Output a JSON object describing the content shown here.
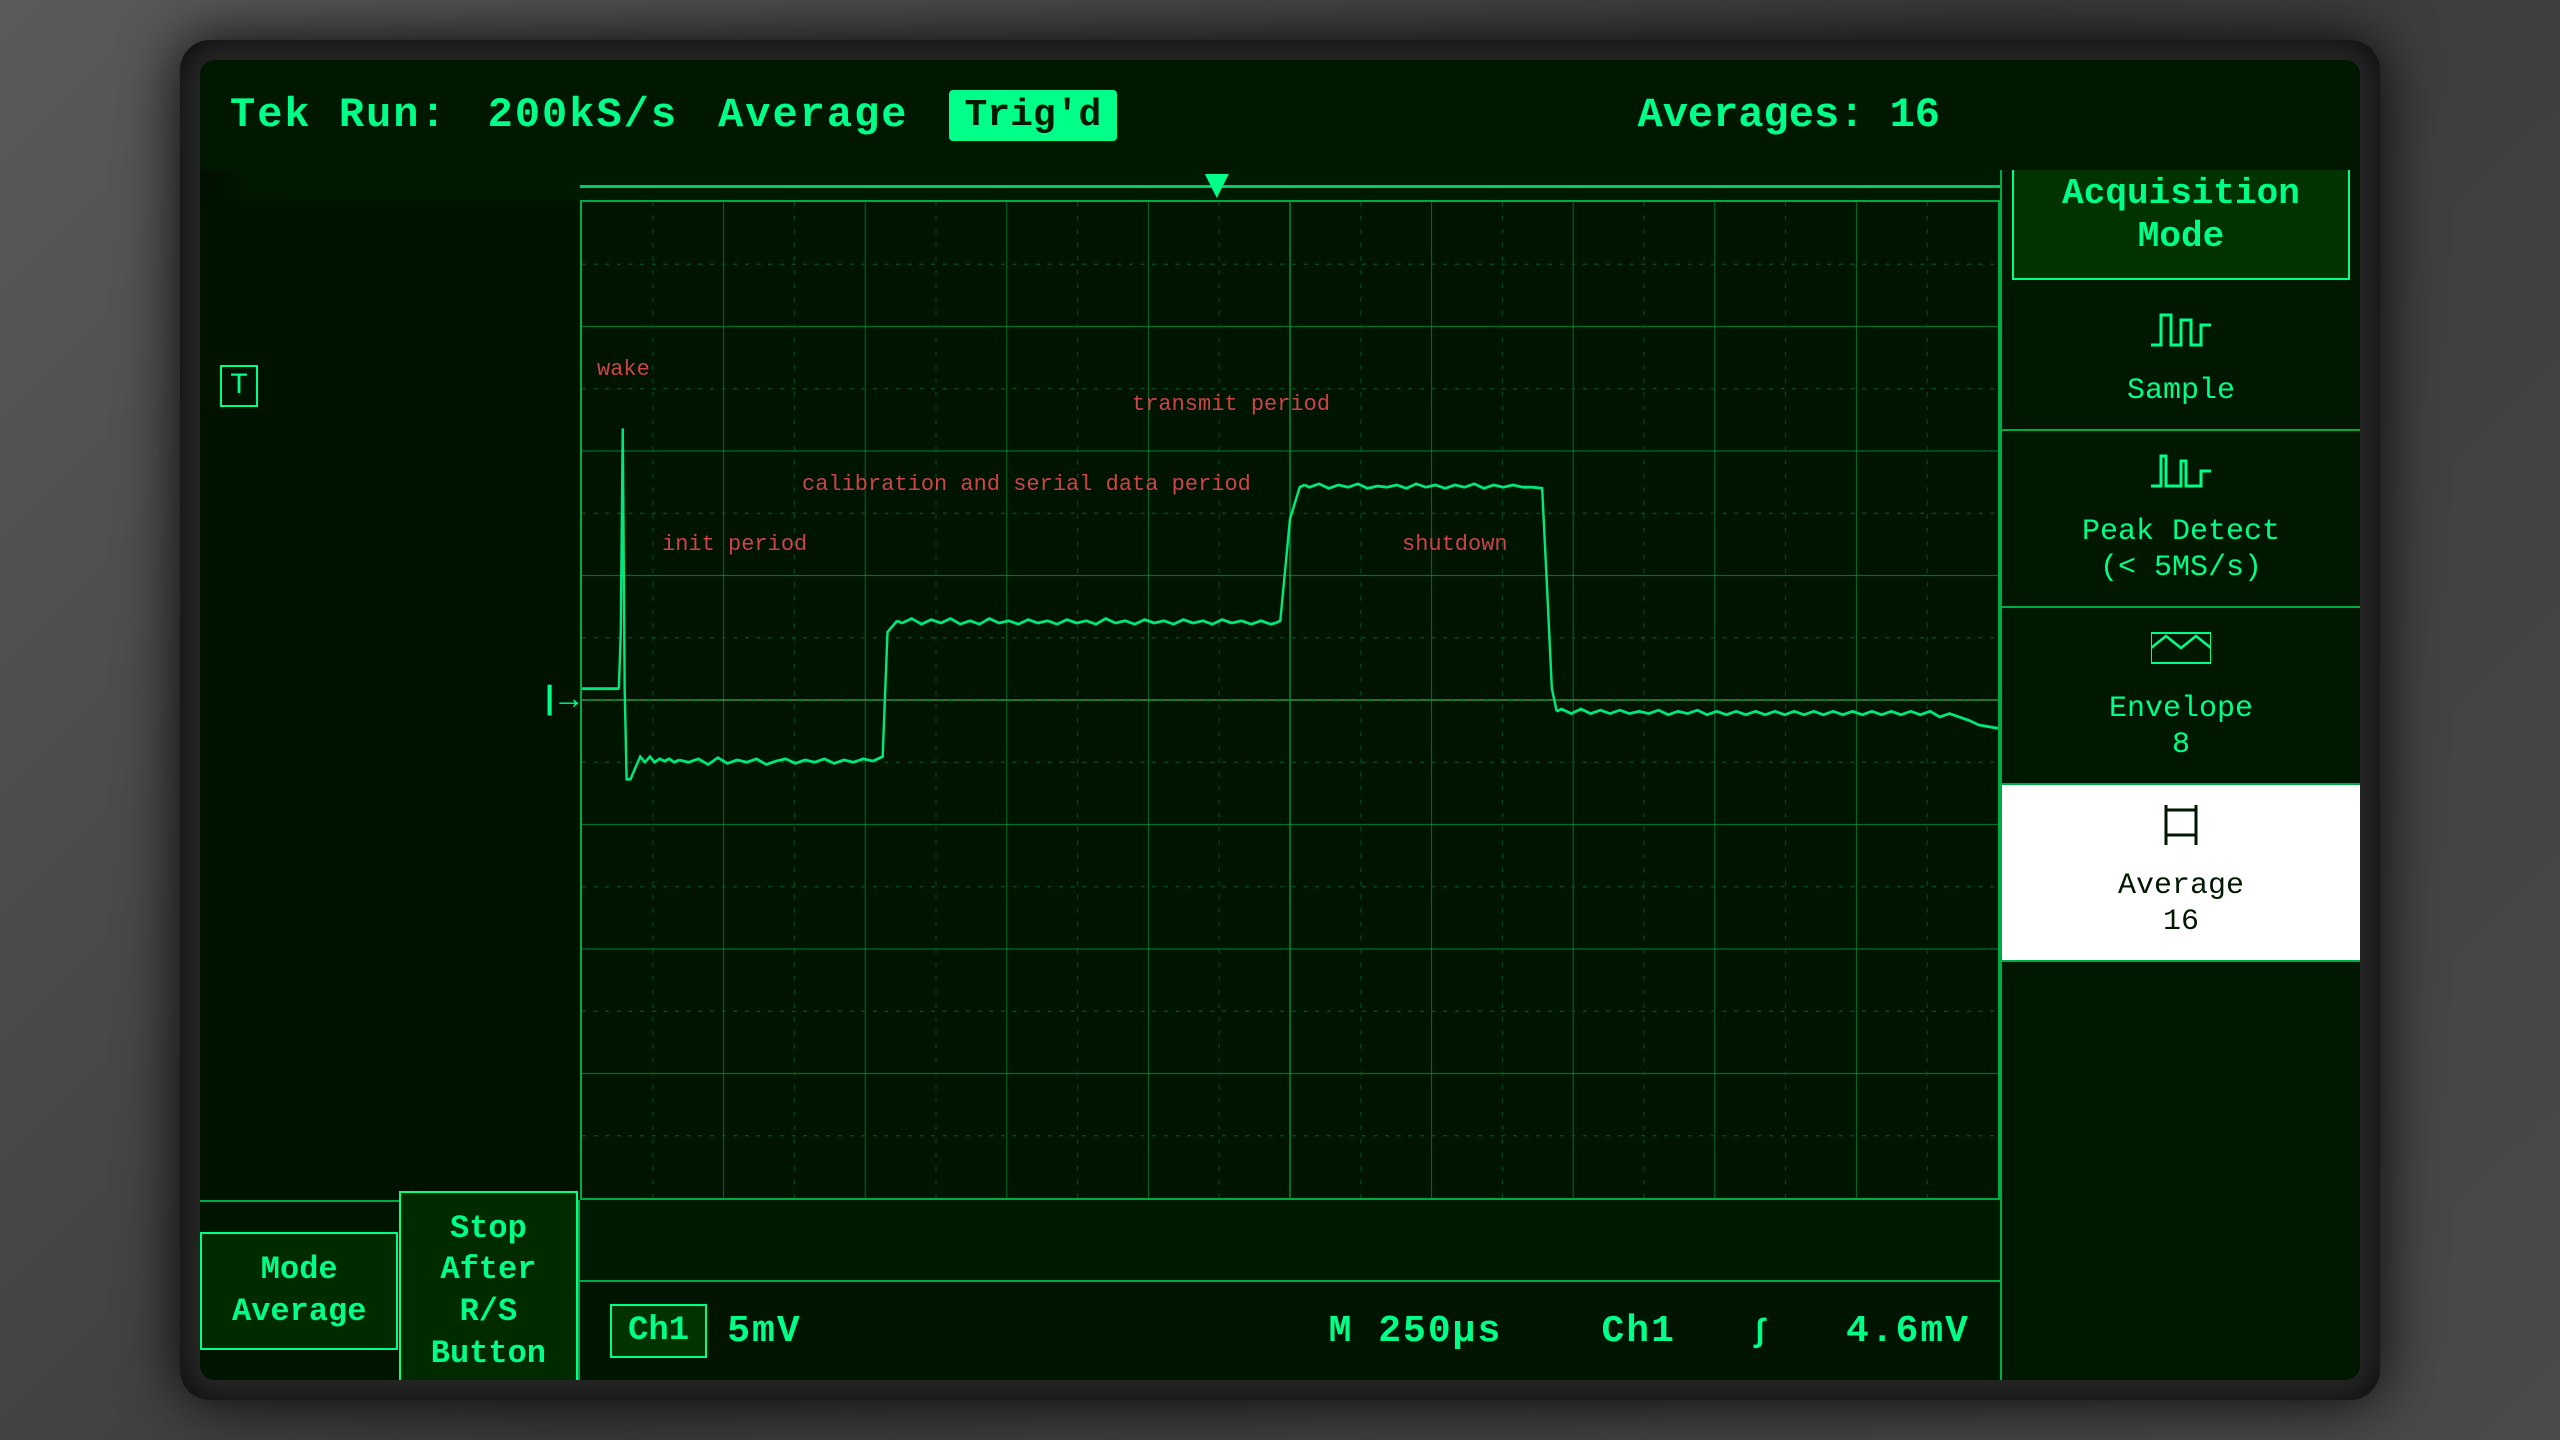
{
  "header": {
    "run_status": "Tek Run:",
    "sample_rate": "200kS/s",
    "mode": "Average",
    "trigger_label": "Trig'd",
    "averages_label": "Averages:",
    "averages_value": "16"
  },
  "grid": {
    "rows": 8,
    "cols": 10
  },
  "signal_labels": {
    "wake": "wake",
    "init_period": "init period",
    "calibration": "calibration and serial data period",
    "transmit_period": "transmit period",
    "shutdown": "shutdown"
  },
  "bottom_bar": {
    "ch1_label": "Ch1",
    "voltage_div": "5mV",
    "time_div": "M 250µs",
    "ch_ref": "Ch1",
    "trigger_level": "4.6mV"
  },
  "mode_bar": {
    "mode_label": "Mode",
    "mode_value": "Average",
    "stop_label": "Stop After",
    "stop_value": "R/S Button"
  },
  "sidebar": {
    "title": "Acquisition\nMode",
    "items": [
      {
        "label": "Sample",
        "icon": "sample",
        "active": false
      },
      {
        "label": "Peak Detect\n(< 5MS/s)",
        "icon": "peak",
        "active": false
      },
      {
        "label": "Envelope\n8",
        "icon": "envelope",
        "active": false
      },
      {
        "label": "Average\n16",
        "icon": "average",
        "active": true
      }
    ]
  }
}
